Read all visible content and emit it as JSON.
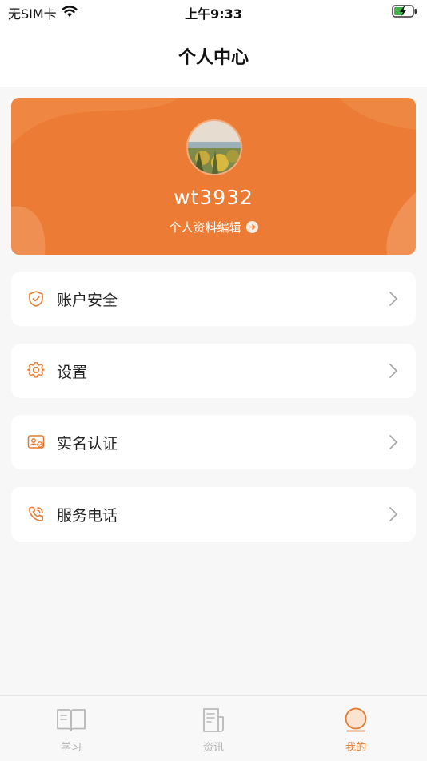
{
  "status_bar": {
    "carrier": "无SIM卡",
    "time": "上午9:33"
  },
  "nav": {
    "title": "个人中心"
  },
  "profile": {
    "username": "wt3932",
    "edit_label": "个人资料编辑"
  },
  "menu": [
    {
      "label": "账户安全",
      "icon": "shield-icon"
    },
    {
      "label": "设置",
      "icon": "gear-icon"
    },
    {
      "label": "实名认证",
      "icon": "id-card-icon"
    },
    {
      "label": "服务电话",
      "icon": "phone-icon"
    }
  ],
  "tabs": [
    {
      "label": "学习",
      "icon": "book-icon",
      "active": false
    },
    {
      "label": "资讯",
      "icon": "document-icon",
      "active": false
    },
    {
      "label": "我的",
      "icon": "profile-circle-icon",
      "active": true
    }
  ],
  "colors": {
    "accent": "#EC7C35",
    "tab_active": "#E47A31",
    "tab_inactive": "#B0B0B0",
    "background": "#F7F7F7"
  }
}
